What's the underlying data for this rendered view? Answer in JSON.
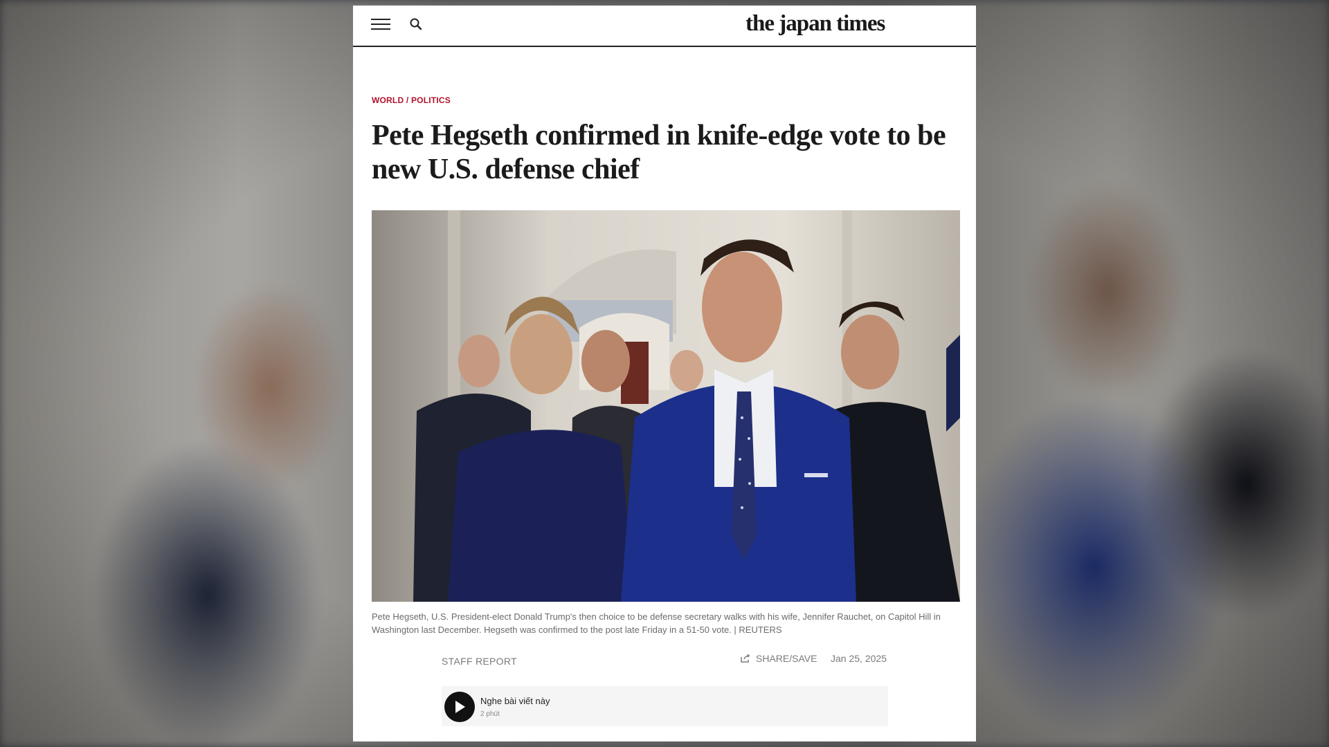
{
  "header": {
    "logo": "the japan times",
    "menu_icon": "hamburger-menu-icon",
    "search_icon": "search-icon"
  },
  "breadcrumb": {
    "section": "WORLD",
    "separator": "/",
    "subsection": "POLITICS"
  },
  "article": {
    "headline": "Pete Hegseth confirmed in knife-edge vote to be new U.S. defense chief",
    "caption": "Pete Hegseth, U.S. President-elect Donald Trump's then choice to be defense secretary walks with his wife, Jennifer Rauchet, on Capitol Hill in Washington last December. Hegseth was confirmed to the post late Friday in a 51-50 vote. | REUTERS",
    "byline": "STAFF REPORT",
    "share_label": "SHARE/SAVE",
    "date": "Jan 25, 2025"
  },
  "audio_player": {
    "title": "Nghe bài viết này",
    "duration": "2 phút",
    "play_icon": "play-icon"
  },
  "colors": {
    "accent": "#b0122b",
    "headline": "#1b1b1b",
    "suit_blue": "#1c2f8a"
  }
}
